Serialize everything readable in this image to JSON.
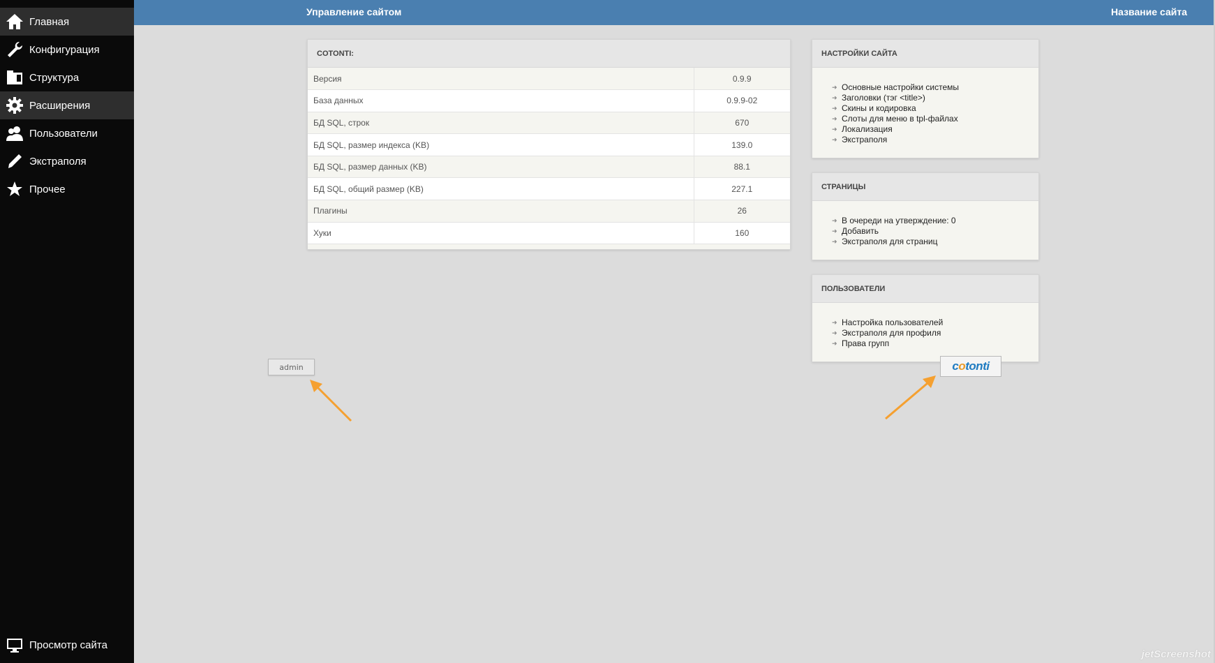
{
  "sidebar": {
    "items": [
      {
        "label": "Главная",
        "icon": "home-icon"
      },
      {
        "label": "Конфигурация",
        "icon": "wrench-icon"
      },
      {
        "label": "Структура",
        "icon": "folder-icon"
      },
      {
        "label": "Расширения",
        "icon": "gear-icon"
      },
      {
        "label": "Пользователи",
        "icon": "users-icon"
      },
      {
        "label": "Экстраполя",
        "icon": "pencil-icon"
      },
      {
        "label": "Прочее",
        "icon": "star-icon"
      }
    ],
    "bottom_item": {
      "label": "Просмотр сайта",
      "icon": "monitor-icon"
    }
  },
  "header": {
    "title": "Управление сайтом",
    "site_name": "Название сайта"
  },
  "cotonti_panel": {
    "title": "COTONTI:",
    "rows": [
      {
        "label": "Версия",
        "value": "0.9.9"
      },
      {
        "label": "База данных",
        "value": "0.9.9-02"
      },
      {
        "label": "БД SQL, строк",
        "value": "670"
      },
      {
        "label": "БД SQL, размер индекса (KB)",
        "value": "139.0"
      },
      {
        "label": "БД SQL, размер данных (KB)",
        "value": "88.1"
      },
      {
        "label": "БД SQL, общий размер (KB)",
        "value": "227.1"
      },
      {
        "label": "Плагины",
        "value": "26"
      },
      {
        "label": "Хуки",
        "value": "160"
      }
    ]
  },
  "site_settings": {
    "title": "НАСТРОЙКИ САЙТА",
    "links": [
      "Основные настройки системы",
      "Заголовки (тэг <title>)",
      "Скины и кодировка",
      "Слоты для меню в tpl-файлах",
      "Локализация",
      "Экстраполя"
    ]
  },
  "pages": {
    "title": "СТРАНИЦЫ",
    "links": [
      "В очереди на утверждение: 0",
      "Добавить",
      "Экстраполя для страниц"
    ]
  },
  "users": {
    "title": "ПОЛЬЗОВАТЕЛИ",
    "links": [
      "Настройка пользователей",
      "Экстраполя для профиля",
      "Права групп"
    ]
  },
  "admin_button": "admin",
  "cotonti_logo": {
    "c": "c",
    "o": "o",
    "rest": "tonti"
  },
  "watermark": "jetScreenshot",
  "colors": {
    "topbar": "#4a7fb0",
    "sidebar": "#0a0a0a",
    "sidebar_active": "#2e2e2e",
    "background": "#dcdcdc",
    "annotation_arrow": "#f5a030"
  }
}
